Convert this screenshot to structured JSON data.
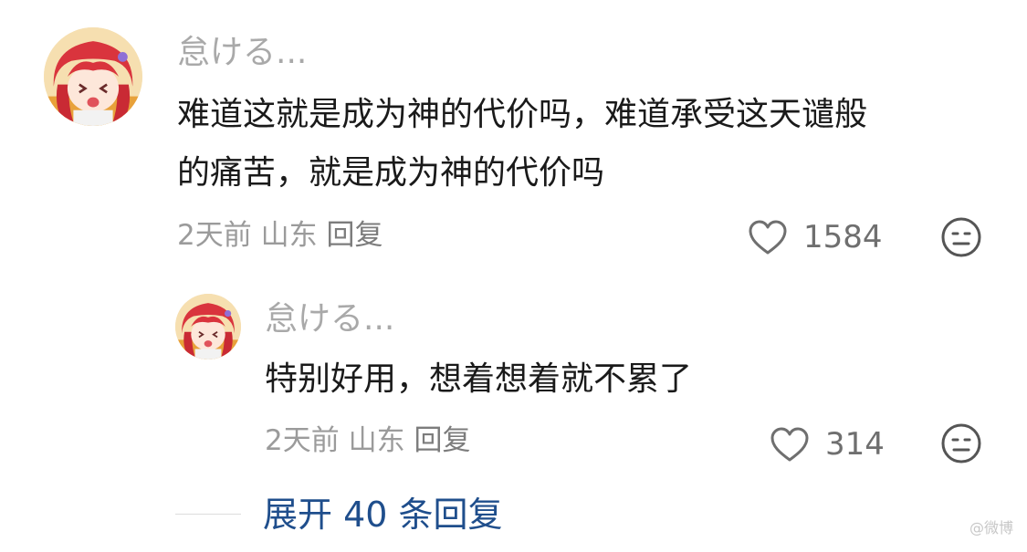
{
  "comment": {
    "username": "怠ける...",
    "text_line1": "难道这就是成为神的代价吗，难道承受这天谴般",
    "text_line2": "的痛苦，就是成为神的代价吗",
    "time": "2天前",
    "location": "山东",
    "reply_label": "回复",
    "likes": "1584",
    "avatar_icon": "anime-girl-red-hair-avatar",
    "reaction_icon": "neutral-face-icon"
  },
  "reply": {
    "username": "怠ける...",
    "text": "特别好用，想着想着就不累了",
    "time": "2天前",
    "location": "山东",
    "reply_label": "回复",
    "likes": "314",
    "avatar_icon": "anime-girl-red-hair-avatar",
    "reaction_icon": "neutral-face-icon"
  },
  "expand": {
    "label": "展开 40 条回复"
  },
  "watermark": {
    "text": "@微博"
  },
  "colors": {
    "username": "#a9a9a9",
    "meta": "#9b9b9b",
    "link": "#1f4e8c"
  }
}
